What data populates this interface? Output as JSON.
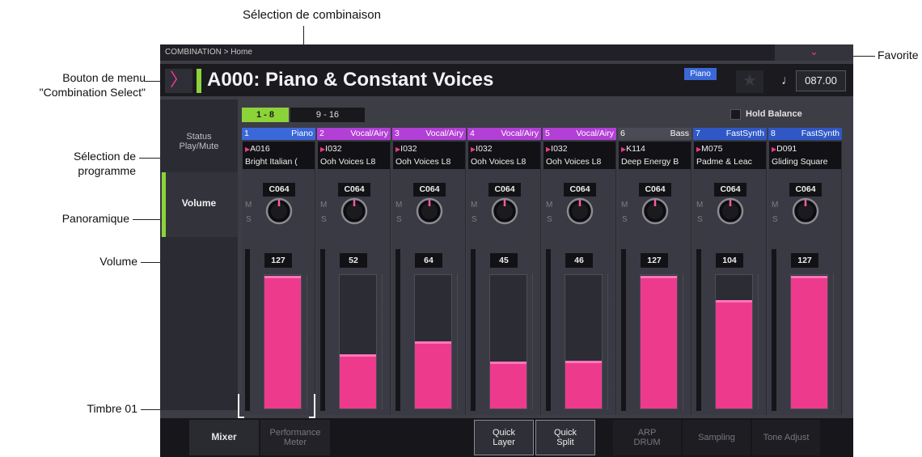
{
  "annotations": {
    "combination_select": "Sélection de combinaison",
    "favorite": "Favorite",
    "menu_button_line1": "Bouton de menu",
    "menu_button_line2": "\"Combination Select\"",
    "program_select_line1": "Sélection de",
    "program_select_line2": "programme",
    "pan": "Panoramique",
    "volume": "Volume",
    "timbre": "Timbre 01"
  },
  "header": {
    "breadcrumb": "COMBINATION > Home",
    "combination_title": "A000: Piano & Constant Voices",
    "category_badge": "Piano",
    "tempo": "087.00",
    "note_icon": "♩",
    "star_icon": "★",
    "menu_icon": "〉",
    "top_chevron": "⌄"
  },
  "nav": {
    "status_line1": "Status",
    "status_line2": "Play/Mute",
    "volume": "Volume"
  },
  "banks": {
    "tab1": "1 - 8",
    "tab2": "9 - 16",
    "hold_balance": "Hold Balance"
  },
  "colors": {
    "accent": "#8cd33a",
    "pink": "#ee3a8c",
    "piano": "#3a68d8",
    "vocal": "#b23fd6",
    "bass": "#4b4b55",
    "synth": "#2f58c6"
  },
  "timbres": [
    {
      "num": "1",
      "category": "Piano",
      "cat_color": "#3a68d8",
      "program": "A016",
      "name": "Bright Italian (",
      "pan": "C064",
      "volume": "127",
      "level": 127
    },
    {
      "num": "2",
      "category": "Vocal/Airy",
      "cat_color": "#b23fd6",
      "program": "I032",
      "name": "Ooh Voices L8",
      "pan": "C064",
      "volume": "52",
      "level": 52
    },
    {
      "num": "3",
      "category": "Vocal/Airy",
      "cat_color": "#b23fd6",
      "program": "I032",
      "name": "Ooh Voices L8",
      "pan": "C064",
      "volume": "64",
      "level": 64
    },
    {
      "num": "4",
      "category": "Vocal/Airy",
      "cat_color": "#b23fd6",
      "program": "I032",
      "name": "Ooh Voices L8",
      "pan": "C064",
      "volume": "45",
      "level": 45
    },
    {
      "num": "5",
      "category": "Vocal/Airy",
      "cat_color": "#b23fd6",
      "program": "I032",
      "name": "Ooh Voices L8",
      "pan": "C064",
      "volume": "46",
      "level": 46
    },
    {
      "num": "6",
      "category": "Bass",
      "cat_color": "#4b4b55",
      "program": "K114",
      "name": "Deep Energy B",
      "pan": "C064",
      "volume": "127",
      "level": 127
    },
    {
      "num": "7",
      "category": "FastSynth",
      "cat_color": "#2f58c6",
      "program": "M075",
      "name": "Padme & Leac",
      "pan": "C064",
      "volume": "104",
      "level": 104
    },
    {
      "num": "8",
      "category": "FastSynth",
      "cat_color": "#2f58c6",
      "program": "D091",
      "name": "Gliding Square",
      "pan": "C064",
      "volume": "127",
      "level": 127
    }
  ],
  "strip_labels": {
    "m": "M",
    "s": "S"
  },
  "bottom_tabs": {
    "mixer": "Mixer",
    "performance_line1": "Performance",
    "performance_line2": "Meter",
    "quick_layer_line1": "Quick",
    "quick_layer_line2": "Layer",
    "quick_split_line1": "Quick",
    "quick_split_line2": "Split",
    "arp_line1": "ARP",
    "arp_line2": "DRUM",
    "sampling": "Sampling",
    "tone_adjust": "Tone Adjust"
  }
}
